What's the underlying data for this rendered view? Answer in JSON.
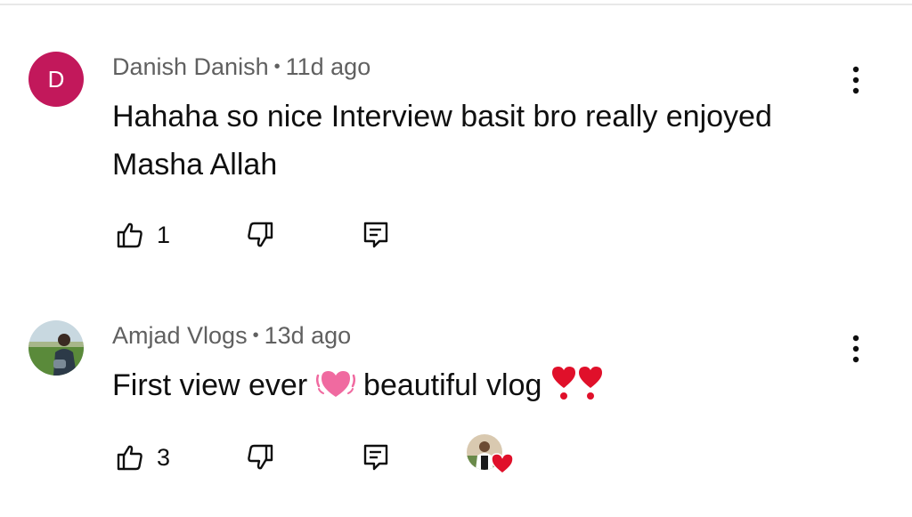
{
  "comments": [
    {
      "author": "Danish Danish",
      "time": "11d ago",
      "avatar_letter": "D",
      "avatar_color": "#c2185b",
      "text": "Hahaha so nice Interview basit bro really enjoyed Masha Allah",
      "likes": "1",
      "creator_heart": false
    },
    {
      "author": "Amjad Vlogs",
      "time": "13d ago",
      "avatar_type": "photo",
      "text_part1": "First view ever",
      "emoji1": "beating-pink-heart",
      "text_part2": "beautiful vlog",
      "emoji2": "red-exclamation-heart",
      "likes": "3",
      "creator_heart": true
    }
  ],
  "icons": {
    "like": "thumbs-up-icon",
    "dislike": "thumbs-down-icon",
    "reply": "reply-icon",
    "more": "more-vert-icon"
  },
  "colors": {
    "meta_text": "#606060",
    "body_text": "#0f0f0f",
    "heart_red": "#e0102a"
  }
}
